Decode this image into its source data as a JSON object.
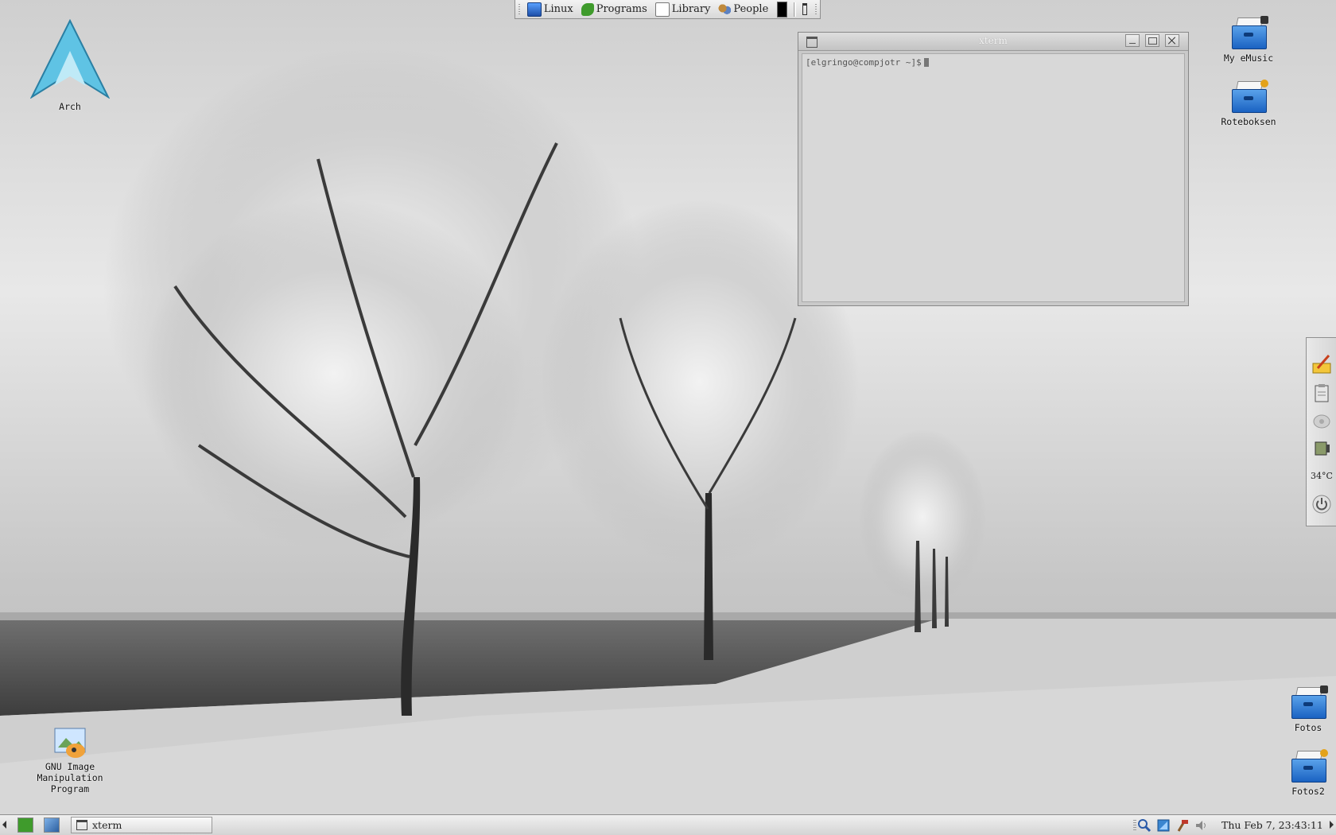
{
  "top_panel": {
    "items": [
      {
        "label": "Linux",
        "icon": "computer-icon"
      },
      {
        "label": "Programs",
        "icon": "programs-icon"
      },
      {
        "label": "Library",
        "icon": "document-icon"
      },
      {
        "label": "People",
        "icon": "people-icon"
      }
    ]
  },
  "xterm": {
    "title": "xterm",
    "prompt": "[elgringo@compjotr ~]$"
  },
  "desktop_icons": {
    "arch": "Arch",
    "gimp_line1": "GNU Image",
    "gimp_line2": "Manipulation",
    "gimp_line3": "Program",
    "my_emusic": "My eMusic",
    "roteboksen": "Roteboksen",
    "fotos": "Fotos",
    "fotos2": "Fotos2"
  },
  "side_dock": {
    "temperature": "34°C"
  },
  "taskbar": {
    "task_label": "xterm",
    "clock": "Thu Feb  7, 23:43:11"
  },
  "colors": {
    "arch_blue": "#5fc3e4",
    "folder_blue": "#2a7bd8"
  }
}
